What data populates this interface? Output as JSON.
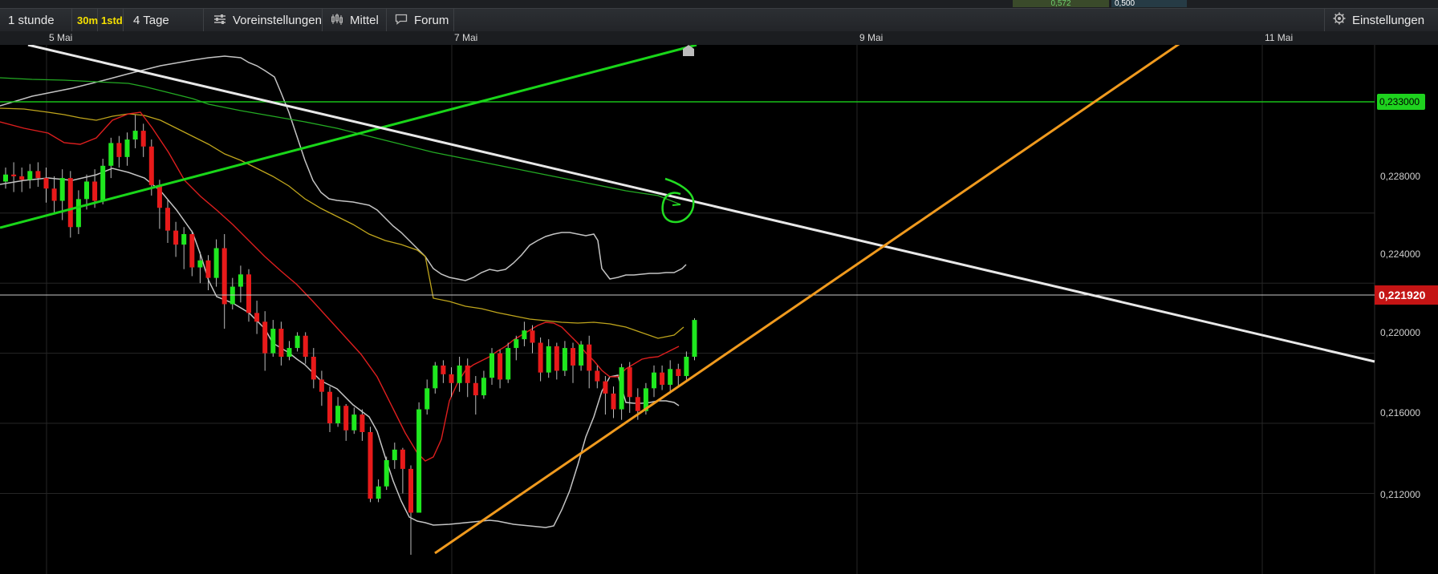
{
  "top_strip": {
    "value_left": "0,572",
    "value_right": "0,500"
  },
  "toolbar": {
    "timeframe": "1 stunde",
    "interval_30m": "30m",
    "interval_1std": "1std",
    "range": "4 Tage",
    "presets_label": "Voreinstellungen",
    "indicator_label": "Mittel",
    "forum_label": "Forum",
    "settings_label": "Einstellungen"
  },
  "chart_data": {
    "type": "candlestick",
    "x_tick_labels": [
      "5 Mai",
      "7 Mai",
      "9 Mai",
      "11 Mai"
    ],
    "y_tick_labels": [
      "0,228000",
      "0,224000",
      "0,220000",
      "0,216000",
      "0,212000"
    ],
    "ylim": [
      0.2074,
      0.2376
    ],
    "grid": true,
    "current_price": "0,221920",
    "current_price_value": 0.22192,
    "price_line_label": "0,233000",
    "price_line_value": 0.233,
    "candles": [
      [
        0.2298,
        0.2302,
        0.2294,
        0.2306
      ],
      [
        0.2302,
        0.2301,
        0.2292,
        0.2309
      ],
      [
        0.2301,
        0.2299,
        0.2292,
        0.2306
      ],
      [
        0.2299,
        0.2304,
        0.2294,
        0.2308
      ],
      [
        0.2304,
        0.23,
        0.2295,
        0.2309
      ],
      [
        0.23,
        0.2294,
        0.2286,
        0.2306
      ],
      [
        0.2294,
        0.2287,
        0.228,
        0.2301
      ],
      [
        0.2287,
        0.23,
        0.2276,
        0.2305
      ],
      [
        0.23,
        0.2272,
        0.2266,
        0.2304
      ],
      [
        0.2272,
        0.2288,
        0.2268,
        0.2293
      ],
      [
        0.2288,
        0.2298,
        0.2282,
        0.2302
      ],
      [
        0.2298,
        0.2287,
        0.2283,
        0.2305
      ],
      [
        0.2287,
        0.2307,
        0.2285,
        0.2311
      ],
      [
        0.2307,
        0.232,
        0.23,
        0.2323
      ],
      [
        0.232,
        0.2312,
        0.2306,
        0.2324
      ],
      [
        0.2312,
        0.2322,
        0.2307,
        0.2326
      ],
      [
        0.2322,
        0.2327,
        0.2317,
        0.2336
      ],
      [
        0.2327,
        0.2318,
        0.2312,
        0.2331
      ],
      [
        0.2318,
        0.2296,
        0.229,
        0.2322
      ],
      [
        0.2296,
        0.2283,
        0.2271,
        0.2299
      ],
      [
        0.2283,
        0.227,
        0.2263,
        0.2288
      ],
      [
        0.227,
        0.2262,
        0.2255,
        0.2275
      ],
      [
        0.2262,
        0.2268,
        0.2248,
        0.2272
      ],
      [
        0.2268,
        0.2249,
        0.2244,
        0.227
      ],
      [
        0.2249,
        0.2253,
        0.224,
        0.2258
      ],
      [
        0.2253,
        0.2243,
        0.2236,
        0.2256
      ],
      [
        0.2243,
        0.226,
        0.2238,
        0.2265
      ],
      [
        0.226,
        0.2228,
        0.2214,
        0.2268
      ],
      [
        0.2228,
        0.2238,
        0.2225,
        0.2243
      ],
      [
        0.2238,
        0.2245,
        0.2229,
        0.225
      ],
      [
        0.2245,
        0.2223,
        0.2218,
        0.2248
      ],
      [
        0.2223,
        0.2218,
        0.2211,
        0.223
      ],
      [
        0.2218,
        0.22,
        0.219,
        0.2224
      ],
      [
        0.22,
        0.2214,
        0.2198,
        0.2219
      ],
      [
        0.2214,
        0.2198,
        0.2193,
        0.2218
      ],
      [
        0.2198,
        0.2203,
        0.2196,
        0.2207
      ],
      [
        0.2203,
        0.221,
        0.2201,
        0.2212
      ],
      [
        0.221,
        0.2198,
        0.2194,
        0.2212
      ],
      [
        0.2198,
        0.2185,
        0.218,
        0.2203
      ],
      [
        0.2185,
        0.2178,
        0.217,
        0.219
      ],
      [
        0.2178,
        0.216,
        0.2155,
        0.2181
      ],
      [
        0.216,
        0.217,
        0.2158,
        0.2175
      ],
      [
        0.217,
        0.2156,
        0.215,
        0.2171
      ],
      [
        0.2156,
        0.2165,
        0.2154,
        0.2169
      ],
      [
        0.2165,
        0.2155,
        0.215,
        0.2168
      ],
      [
        0.2155,
        0.2117,
        0.2115,
        0.2158
      ],
      [
        0.2117,
        0.2124,
        0.2115,
        0.2128
      ],
      [
        0.2124,
        0.2139,
        0.2122,
        0.2141
      ],
      [
        0.2139,
        0.2145,
        0.2134,
        0.2149
      ],
      [
        0.2145,
        0.2134,
        0.212,
        0.2146
      ],
      [
        0.2134,
        0.2109,
        0.2085,
        0.2136
      ],
      [
        0.2109,
        0.2168,
        0.2109,
        0.2172
      ],
      [
        0.2168,
        0.218,
        0.2165,
        0.2185
      ],
      [
        0.218,
        0.2193,
        0.2177,
        0.2195
      ],
      [
        0.2193,
        0.2188,
        0.2183,
        0.2196
      ],
      [
        0.2188,
        0.2183,
        0.2175,
        0.2192
      ],
      [
        0.2183,
        0.2193,
        0.2178,
        0.2198
      ],
      [
        0.2193,
        0.2183,
        0.2175,
        0.2197
      ],
      [
        0.2183,
        0.2176,
        0.2165,
        0.2187
      ],
      [
        0.2176,
        0.2186,
        0.2174,
        0.219
      ],
      [
        0.2186,
        0.22,
        0.2182,
        0.2203
      ],
      [
        0.22,
        0.2185,
        0.218,
        0.2202
      ],
      [
        0.2185,
        0.2203,
        0.2183,
        0.2206
      ],
      [
        0.2203,
        0.2208,
        0.2196,
        0.221
      ],
      [
        0.2208,
        0.2213,
        0.2204,
        0.2218
      ],
      [
        0.2213,
        0.2206,
        0.22,
        0.2216
      ],
      [
        0.2206,
        0.2189,
        0.2184,
        0.2209
      ],
      [
        0.2189,
        0.2204,
        0.2186,
        0.2208
      ],
      [
        0.2204,
        0.219,
        0.2185,
        0.2206
      ],
      [
        0.219,
        0.2203,
        0.2187,
        0.2207
      ],
      [
        0.2203,
        0.2193,
        0.2183,
        0.2206
      ],
      [
        0.2193,
        0.2205,
        0.219,
        0.2207
      ],
      [
        0.2205,
        0.219,
        0.218,
        0.221
      ],
      [
        0.219,
        0.2184,
        0.218,
        0.2193
      ],
      [
        0.2184,
        0.2177,
        0.2165,
        0.2187
      ],
      [
        0.2177,
        0.2168,
        0.2163,
        0.2181
      ],
      [
        0.2168,
        0.2192,
        0.2162,
        0.2194
      ],
      [
        0.2192,
        0.2175,
        0.2166,
        0.2195
      ],
      [
        0.2175,
        0.2167,
        0.2162,
        0.218
      ],
      [
        0.2167,
        0.218,
        0.2165,
        0.2183
      ],
      [
        0.218,
        0.2189,
        0.2175,
        0.2193
      ],
      [
        0.2189,
        0.2182,
        0.2179,
        0.2193
      ],
      [
        0.2182,
        0.2191,
        0.2177,
        0.2196
      ],
      [
        0.2191,
        0.2187,
        0.2181,
        0.2194
      ],
      [
        0.2187,
        0.2198,
        0.2185,
        0.2201
      ],
      [
        0.2198,
        0.2219,
        0.2196,
        0.222
      ]
    ],
    "colors": {
      "up": "#1fe81f",
      "down": "#e81a1a",
      "grid": "#262626",
      "price_line": "#d0d0d0",
      "price_label_bg": "#c41414",
      "level_line": "#18c018",
      "level_label_bg": "#1ed21e",
      "trend_green": "#19d619",
      "trend_white": "#e8e8e8",
      "trend_orange": "#f09a1e",
      "bollinger": "#c4c4c4",
      "ma_fast": "#dd1e1e",
      "ma_mid": "#bfa51c",
      "ma_slow": "#23aa23"
    }
  }
}
